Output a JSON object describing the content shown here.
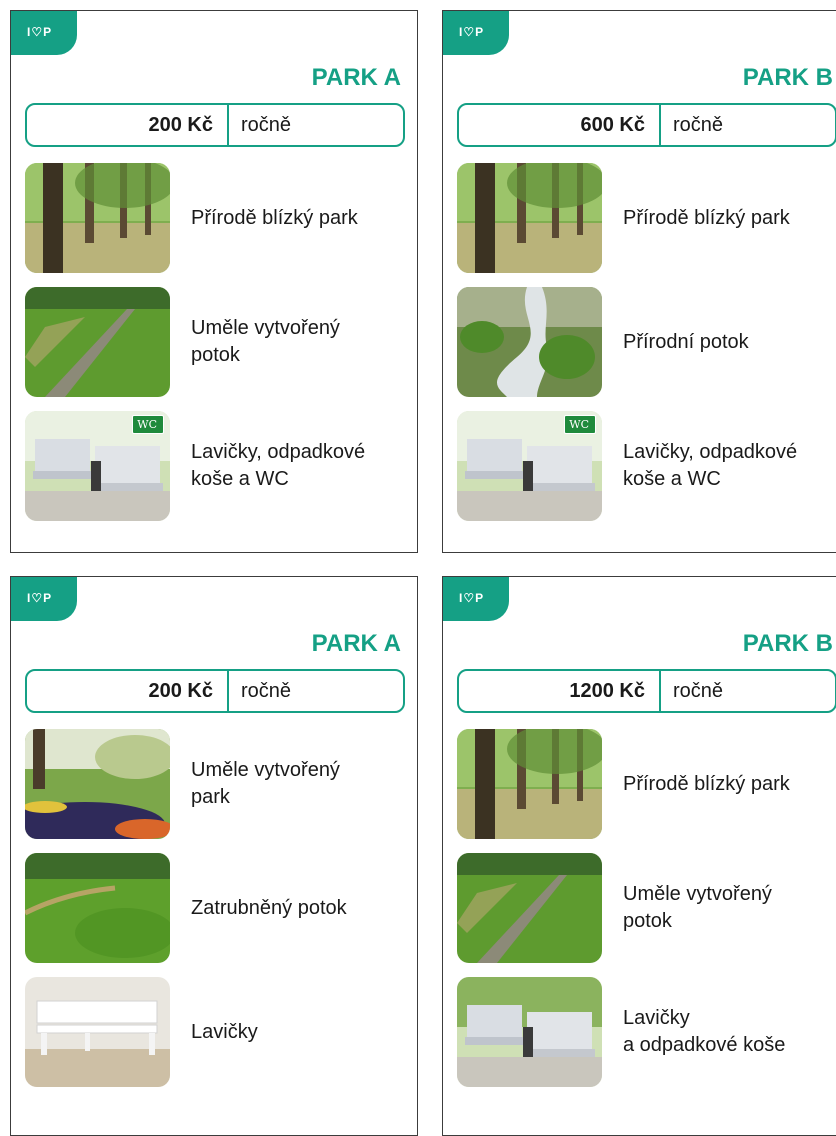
{
  "cards": [
    {
      "logo": "I",
      "logo_rest": "P",
      "title": "PARK A",
      "price": "200 Kč",
      "unit": "ročně",
      "items": [
        {
          "label": "Přírodě blízký park",
          "image": "trees-park"
        },
        {
          "label": "Uměle vytvořený\npotok",
          "image": "concrete-channel"
        },
        {
          "label": "Lavičky, odpadkové\nkoše a WC",
          "image": "benches-wc",
          "sign": "WC"
        }
      ]
    },
    {
      "logo": "I",
      "logo_rest": "P",
      "title": "PARK B",
      "price": "600 Kč",
      "unit": "ročně",
      "items": [
        {
          "label": "Přírodě blízký park",
          "image": "trees-park"
        },
        {
          "label": "Přírodní potok",
          "image": "natural-stream"
        },
        {
          "label": "Lavičky, odpadkové\nkoše a WC",
          "image": "benches-wc",
          "sign": "WC"
        }
      ]
    },
    {
      "logo": "I",
      "logo_rest": "P",
      "title": "PARK A",
      "price": "200 Kč",
      "unit": "ročně",
      "items": [
        {
          "label": "Uměle vytvořený\npark",
          "image": "flower-beds"
        },
        {
          "label": "Zatrubněný potok",
          "image": "grass-field"
        },
        {
          "label": "Lavičky",
          "image": "white-bench"
        }
      ]
    },
    {
      "logo": "I",
      "logo_rest": "P",
      "title": "PARK B",
      "price": "1200 Kč",
      "unit": "ročně",
      "items": [
        {
          "label": "Přírodě blízký park",
          "image": "trees-park"
        },
        {
          "label": "Uměle vytvořený\npotok",
          "image": "concrete-channel"
        },
        {
          "label": "Lavičky\na odpadkové koše",
          "image": "benches"
        }
      ]
    }
  ],
  "colors": {
    "accent": "#15a085",
    "border": "#3c3c3c"
  }
}
